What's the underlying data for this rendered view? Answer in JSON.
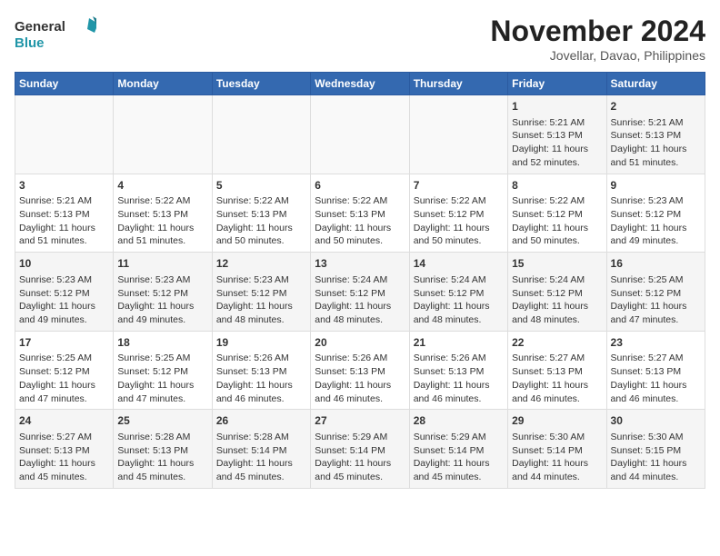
{
  "header": {
    "logo_line1": "General",
    "logo_line2": "Blue",
    "title": "November 2024",
    "subtitle": "Jovellar, Davao, Philippines"
  },
  "days_of_week": [
    "Sunday",
    "Monday",
    "Tuesday",
    "Wednesday",
    "Thursday",
    "Friday",
    "Saturday"
  ],
  "weeks": [
    [
      {
        "day": "",
        "info": ""
      },
      {
        "day": "",
        "info": ""
      },
      {
        "day": "",
        "info": ""
      },
      {
        "day": "",
        "info": ""
      },
      {
        "day": "",
        "info": ""
      },
      {
        "day": "1",
        "info": "Sunrise: 5:21 AM\nSunset: 5:13 PM\nDaylight: 11 hours and 52 minutes."
      },
      {
        "day": "2",
        "info": "Sunrise: 5:21 AM\nSunset: 5:13 PM\nDaylight: 11 hours and 51 minutes."
      }
    ],
    [
      {
        "day": "3",
        "info": "Sunrise: 5:21 AM\nSunset: 5:13 PM\nDaylight: 11 hours and 51 minutes."
      },
      {
        "day": "4",
        "info": "Sunrise: 5:22 AM\nSunset: 5:13 PM\nDaylight: 11 hours and 51 minutes."
      },
      {
        "day": "5",
        "info": "Sunrise: 5:22 AM\nSunset: 5:13 PM\nDaylight: 11 hours and 50 minutes."
      },
      {
        "day": "6",
        "info": "Sunrise: 5:22 AM\nSunset: 5:13 PM\nDaylight: 11 hours and 50 minutes."
      },
      {
        "day": "7",
        "info": "Sunrise: 5:22 AM\nSunset: 5:12 PM\nDaylight: 11 hours and 50 minutes."
      },
      {
        "day": "8",
        "info": "Sunrise: 5:22 AM\nSunset: 5:12 PM\nDaylight: 11 hours and 50 minutes."
      },
      {
        "day": "9",
        "info": "Sunrise: 5:23 AM\nSunset: 5:12 PM\nDaylight: 11 hours and 49 minutes."
      }
    ],
    [
      {
        "day": "10",
        "info": "Sunrise: 5:23 AM\nSunset: 5:12 PM\nDaylight: 11 hours and 49 minutes."
      },
      {
        "day": "11",
        "info": "Sunrise: 5:23 AM\nSunset: 5:12 PM\nDaylight: 11 hours and 49 minutes."
      },
      {
        "day": "12",
        "info": "Sunrise: 5:23 AM\nSunset: 5:12 PM\nDaylight: 11 hours and 48 minutes."
      },
      {
        "day": "13",
        "info": "Sunrise: 5:24 AM\nSunset: 5:12 PM\nDaylight: 11 hours and 48 minutes."
      },
      {
        "day": "14",
        "info": "Sunrise: 5:24 AM\nSunset: 5:12 PM\nDaylight: 11 hours and 48 minutes."
      },
      {
        "day": "15",
        "info": "Sunrise: 5:24 AM\nSunset: 5:12 PM\nDaylight: 11 hours and 48 minutes."
      },
      {
        "day": "16",
        "info": "Sunrise: 5:25 AM\nSunset: 5:12 PM\nDaylight: 11 hours and 47 minutes."
      }
    ],
    [
      {
        "day": "17",
        "info": "Sunrise: 5:25 AM\nSunset: 5:12 PM\nDaylight: 11 hours and 47 minutes."
      },
      {
        "day": "18",
        "info": "Sunrise: 5:25 AM\nSunset: 5:12 PM\nDaylight: 11 hours and 47 minutes."
      },
      {
        "day": "19",
        "info": "Sunrise: 5:26 AM\nSunset: 5:13 PM\nDaylight: 11 hours and 46 minutes."
      },
      {
        "day": "20",
        "info": "Sunrise: 5:26 AM\nSunset: 5:13 PM\nDaylight: 11 hours and 46 minutes."
      },
      {
        "day": "21",
        "info": "Sunrise: 5:26 AM\nSunset: 5:13 PM\nDaylight: 11 hours and 46 minutes."
      },
      {
        "day": "22",
        "info": "Sunrise: 5:27 AM\nSunset: 5:13 PM\nDaylight: 11 hours and 46 minutes."
      },
      {
        "day": "23",
        "info": "Sunrise: 5:27 AM\nSunset: 5:13 PM\nDaylight: 11 hours and 46 minutes."
      }
    ],
    [
      {
        "day": "24",
        "info": "Sunrise: 5:27 AM\nSunset: 5:13 PM\nDaylight: 11 hours and 45 minutes."
      },
      {
        "day": "25",
        "info": "Sunrise: 5:28 AM\nSunset: 5:13 PM\nDaylight: 11 hours and 45 minutes."
      },
      {
        "day": "26",
        "info": "Sunrise: 5:28 AM\nSunset: 5:14 PM\nDaylight: 11 hours and 45 minutes."
      },
      {
        "day": "27",
        "info": "Sunrise: 5:29 AM\nSunset: 5:14 PM\nDaylight: 11 hours and 45 minutes."
      },
      {
        "day": "28",
        "info": "Sunrise: 5:29 AM\nSunset: 5:14 PM\nDaylight: 11 hours and 45 minutes."
      },
      {
        "day": "29",
        "info": "Sunrise: 5:30 AM\nSunset: 5:14 PM\nDaylight: 11 hours and 44 minutes."
      },
      {
        "day": "30",
        "info": "Sunrise: 5:30 AM\nSunset: 5:15 PM\nDaylight: 11 hours and 44 minutes."
      }
    ]
  ]
}
